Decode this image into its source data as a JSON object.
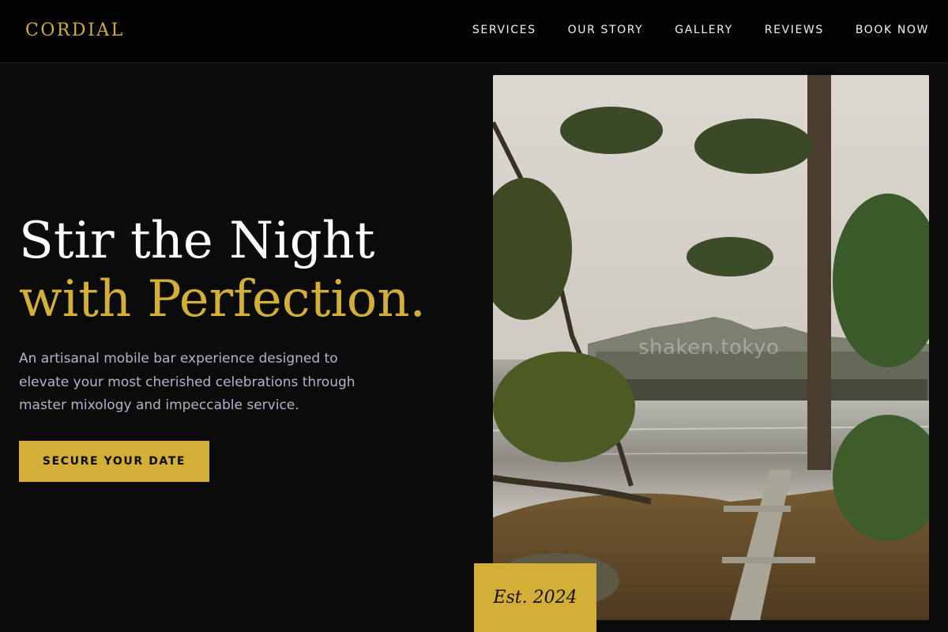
{
  "brand": {
    "logo_text": "CORDIAL",
    "accent_color": "#d4af37"
  },
  "nav": {
    "items": [
      {
        "label": "SERVICES"
      },
      {
        "label": "OUR STORY"
      },
      {
        "label": "GALLERY"
      },
      {
        "label": "REVIEWS"
      },
      {
        "label": "BOOK NOW"
      }
    ]
  },
  "hero": {
    "headline_line1": "Stir the Night",
    "headline_line2": "with Perfection.",
    "description": "An artisanal mobile bar experience designed to elevate your most cherished celebrations through master mixology and impeccable service.",
    "cta_label": "SECURE YOUR DATE"
  },
  "photo": {
    "watermark": "shaken.tokyo",
    "badge_text": "Est. 2024"
  }
}
